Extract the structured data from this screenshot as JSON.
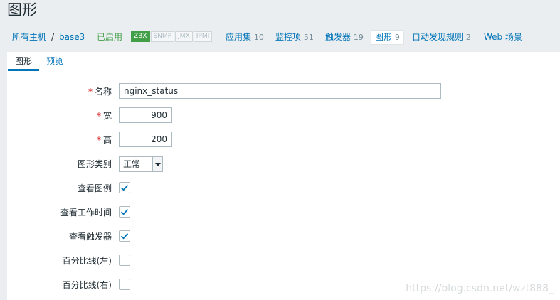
{
  "page_title": "图形",
  "nav": {
    "all_hosts": "所有主机",
    "separator": "/",
    "host": "base3",
    "status": "已启用",
    "availability": [
      "ZBX",
      "SNMP",
      "JMX",
      "IPMI"
    ],
    "applications": {
      "label": "应用集",
      "count": "10"
    },
    "items": {
      "label": "监控项",
      "count": "51"
    },
    "triggers": {
      "label": "触发器",
      "count": "19"
    },
    "graphs": {
      "label": "图形",
      "count": "9"
    },
    "discovery": {
      "label": "自动发现规则",
      "count": "2"
    },
    "web": {
      "label": "Web 场景"
    }
  },
  "tabs": {
    "graph": "图形",
    "preview": "预览"
  },
  "form": {
    "required_mark": "*",
    "name": {
      "label": "名称",
      "value": "nginx_status"
    },
    "width": {
      "label": "宽",
      "value": "900"
    },
    "height": {
      "label": "高",
      "value": "200"
    },
    "graph_type": {
      "label": "图形类别",
      "value": "正常"
    },
    "show_legend": {
      "label": "查看图例",
      "checked": true
    },
    "show_working_time": {
      "label": "查看工作时间",
      "checked": true
    },
    "show_triggers": {
      "label": "查看触发器",
      "checked": true
    },
    "percentile_left": {
      "label": "百分比线(左)",
      "checked": false
    },
    "percentile_right": {
      "label": "百分比线(右)",
      "checked": false
    }
  },
  "watermark": "https://blog.csdn.net/wzt888_",
  "colors": {
    "accent": "#0275b8",
    "enabled": "#429e47",
    "required": "#d40000"
  }
}
